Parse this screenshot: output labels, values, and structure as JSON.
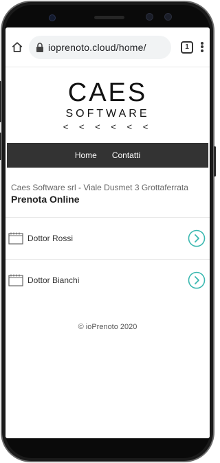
{
  "browser": {
    "url": "ioprenoto.cloud/home/",
    "tab_count": "1"
  },
  "logo": {
    "line1": "CAES",
    "line2": "SOFTWARE",
    "line3": "< < < < < <"
  },
  "nav": {
    "items": [
      "Home",
      "Contatti"
    ]
  },
  "header": {
    "company": "Caes Software srl - Viale Dusmet 3 Grottaferrata",
    "title": "Prenota Online"
  },
  "doctors": [
    {
      "name": "Dottor Rossi"
    },
    {
      "name": "Dottor Bianchi"
    }
  ],
  "footer": {
    "text": "© ioPrenoto 2020"
  },
  "colors": {
    "nav_bg": "#333333",
    "accent": "#3ab8b0"
  },
  "icons": {
    "home": "home-icon",
    "lock": "lock-icon",
    "menu": "more-vert-icon",
    "calendar": "calendar-icon",
    "go": "chevron-right-circle-icon"
  }
}
